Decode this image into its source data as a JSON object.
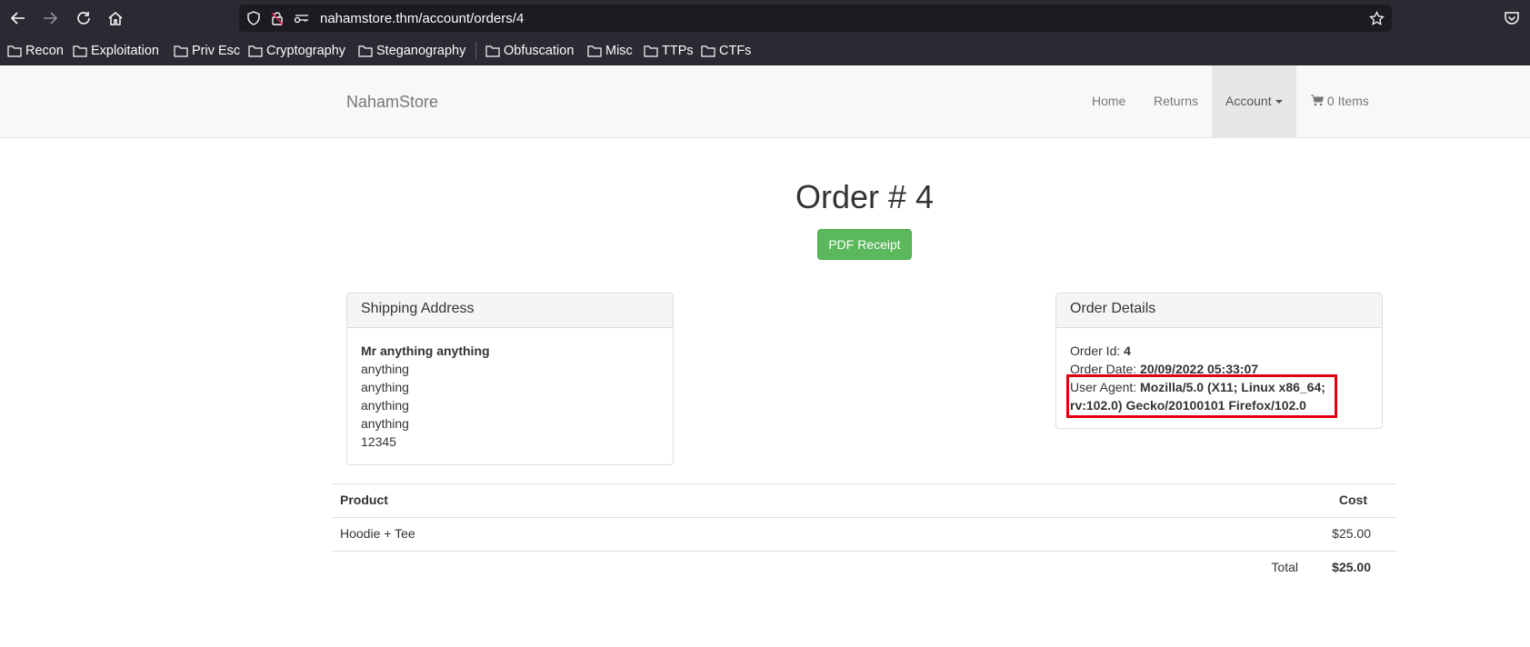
{
  "browser": {
    "url": "nahamstore.thm/account/orders/4",
    "bookmarks": [
      "Recon",
      "Exploitation",
      "Priv Esc",
      "Cryptography",
      "Steganography",
      "Obfuscation",
      "Misc",
      "TTPs",
      "CTFs"
    ]
  },
  "navbar": {
    "brand": "NahamStore",
    "home": "Home",
    "returns": "Returns",
    "account": "Account",
    "cart": "0 Items"
  },
  "order": {
    "title": "Order # 4",
    "pdf_button": "PDF Receipt"
  },
  "shipping": {
    "heading": "Shipping Address",
    "name": "Mr anything anything",
    "lines": [
      "anything",
      "anything",
      "anything",
      "anything",
      "12345"
    ]
  },
  "details": {
    "heading": "Order Details",
    "order_id_label": "Order Id:",
    "order_id": "4",
    "order_date_label": "Order Date:",
    "order_date": "20/09/2022 05:33:07",
    "user_agent_label": "User Agent:",
    "user_agent": "Mozilla/5.0 (X11; Linux x86_64; rv:102.0) Gecko/20100101 Firefox/102.0"
  },
  "table": {
    "col_product": "Product",
    "col_cost": "Cost",
    "rows": [
      {
        "product": "Hoodie + Tee",
        "cost": "$25.00"
      }
    ],
    "total_label": "Total",
    "total_value": "$25.00"
  },
  "colors": {
    "chrome_bg": "#2b2a33",
    "success_button": "#5cb85c",
    "highlight_box": "#e0000f"
  }
}
